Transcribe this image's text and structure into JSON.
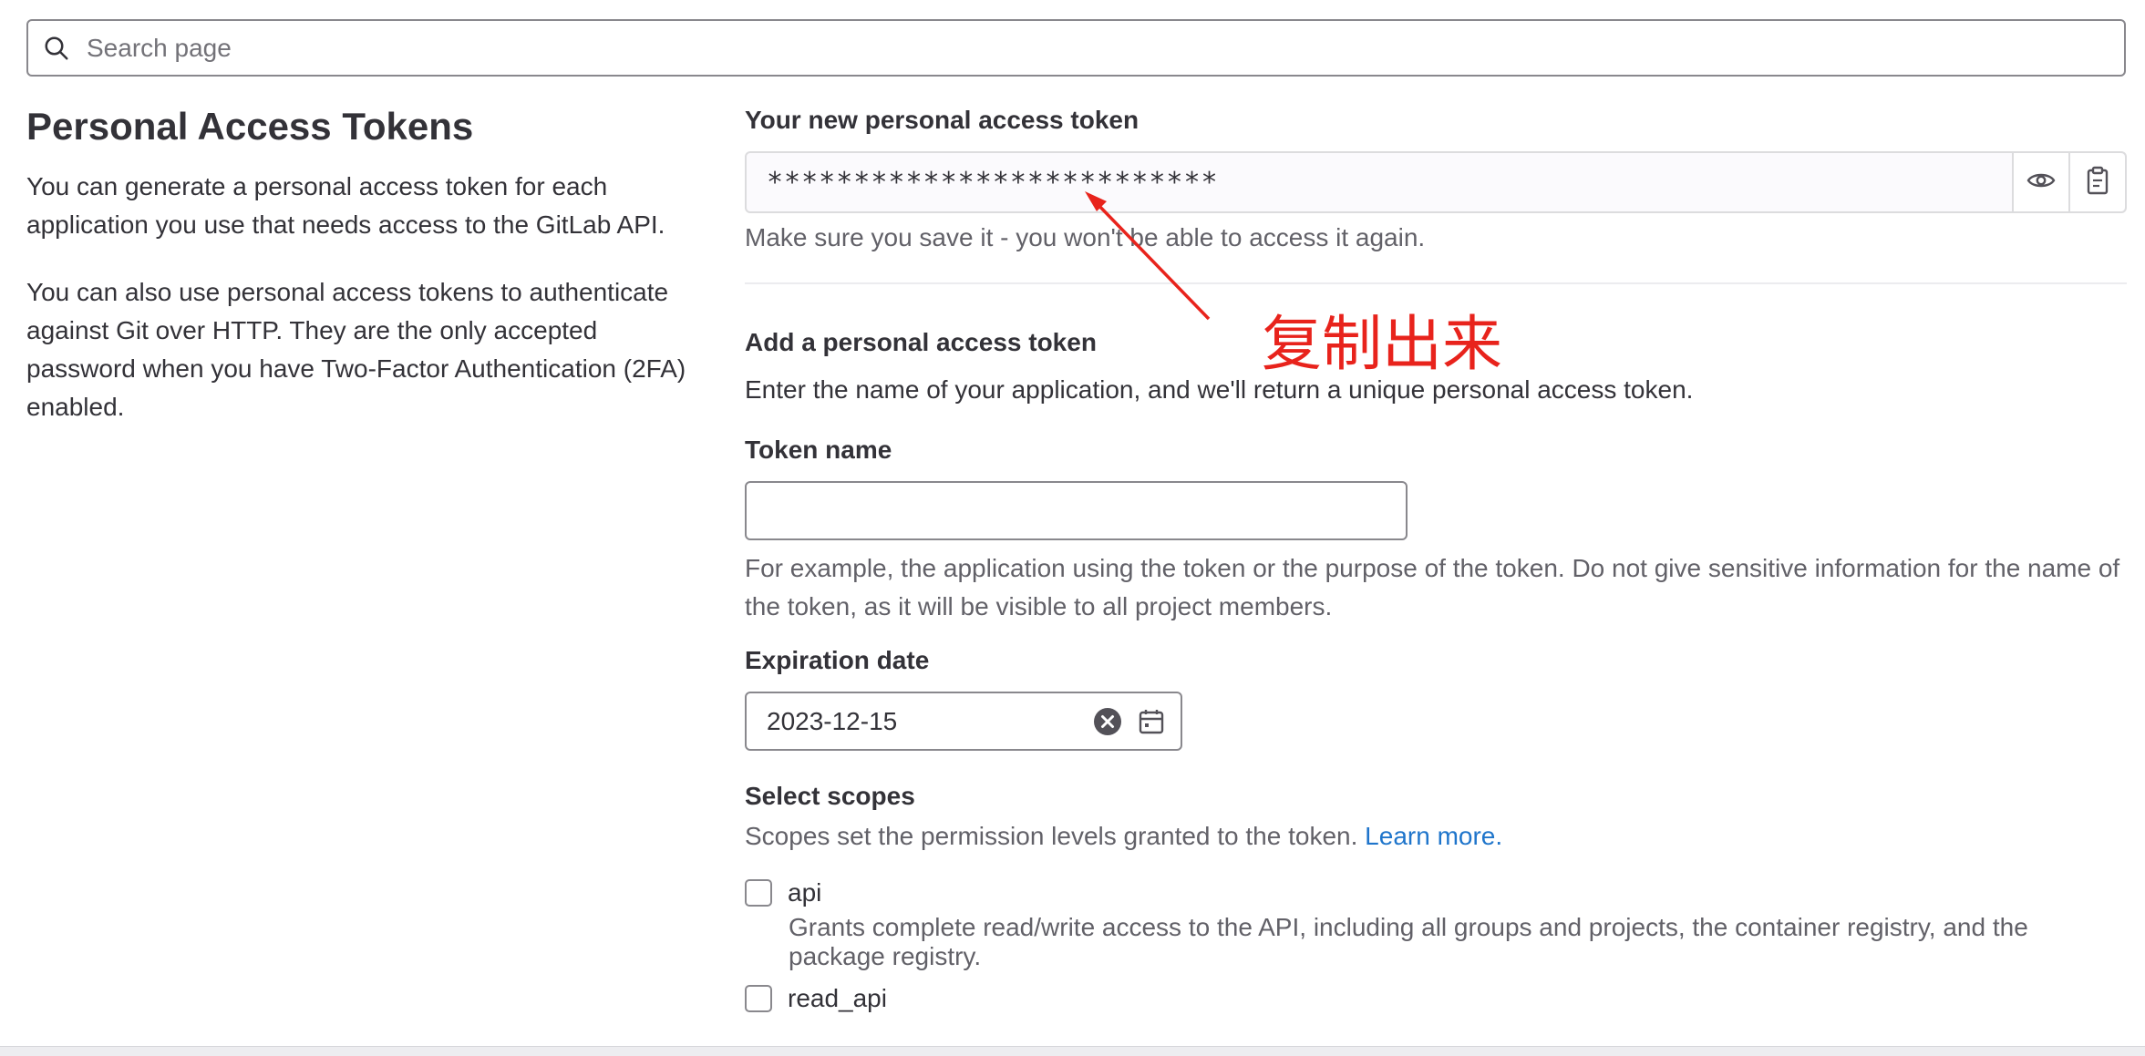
{
  "search": {
    "placeholder": "Search page"
  },
  "left": {
    "title": "Personal Access Tokens",
    "para1": "You can generate a personal access token for each application you use that needs access to the GitLab API.",
    "para2": "You can also use personal access tokens to authenticate against Git over HTTP. They are the only accepted password when you have Two-Factor Authentication (2FA) enabled."
  },
  "new_token": {
    "label": "Your new personal access token",
    "value": "**************************",
    "help": "Make sure you save it - you won't be able to access it again.",
    "icons": [
      "eye-icon",
      "clipboard-icon"
    ]
  },
  "add_token": {
    "heading": "Add a personal access token",
    "description": "Enter the name of your application, and we'll return a unique personal access token."
  },
  "token_name": {
    "label": "Token name",
    "value": "",
    "help": "For example, the application using the token or the purpose of the token. Do not give sensitive information for the name of the token, as it will be visible to all project members."
  },
  "expiration": {
    "label": "Expiration date",
    "value": "2023-12-15",
    "icons": [
      "clear-icon",
      "calendar-icon"
    ]
  },
  "scopes": {
    "heading": "Select scopes",
    "description": "Scopes set the permission levels granted to the token.",
    "learn_more": "Learn more.",
    "items": [
      {
        "name": "api",
        "checked": false,
        "description": "Grants complete read/write access to the API, including all groups and projects, the container registry, and the package registry."
      },
      {
        "name": "read_api",
        "checked": false,
        "description": ""
      }
    ]
  },
  "annotation": {
    "text": "复制出来",
    "color": "#e8231c"
  },
  "colors": {
    "link": "#1f75cb",
    "border": "#89888d",
    "muted_text": "#626168"
  }
}
